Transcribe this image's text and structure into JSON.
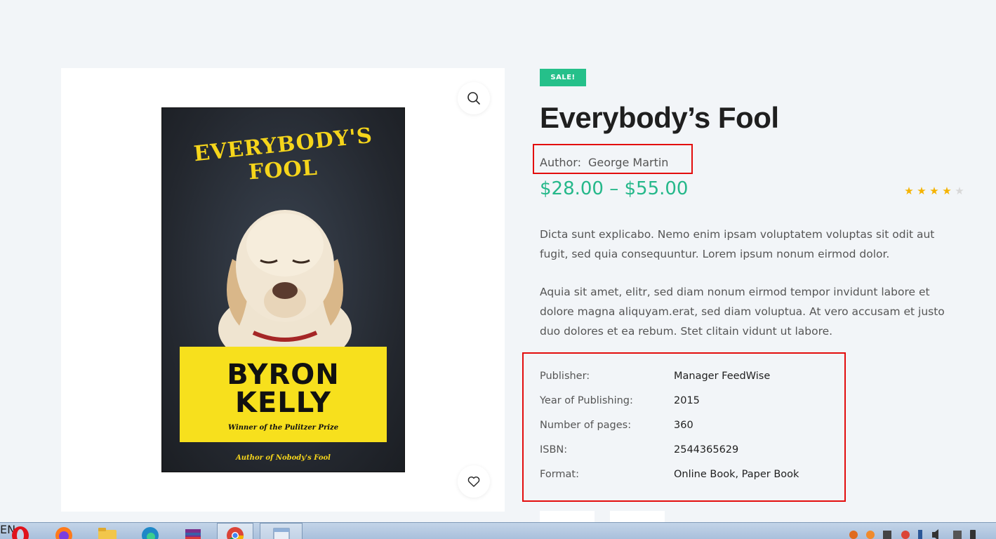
{
  "product": {
    "badge": "SALE!",
    "title": "Everybody’s Fool",
    "author_label": "Author:",
    "author_name": "George Martin",
    "price": "$28.00 – $55.00",
    "rating": 4,
    "rating_max": 5,
    "description": [
      "Dicta sunt explicabo. Nemo enim ipsam voluptatem voluptas sit odit aut fugit, sed quia consequuntur. Lorem ipsum nonum eirmod dolor.",
      "Aquia sit amet, elitr, sed diam nonum eirmod tempor invidunt labore et dolore magna aliquyam.erat, sed diam voluptua. At vero accusam et justo duo dolores et ea rebum. Stet clitain vidunt ut labore."
    ]
  },
  "cover": {
    "title_line1": "EVERYBODY'S",
    "title_line2": "FOOL",
    "author_line1": "BYRON",
    "author_line2": "KELLY",
    "tagline": "Winner of the Pulitzer Prize",
    "footer": "Author of Nobody's Fool"
  },
  "meta": [
    {
      "key": "Publisher:",
      "value": "Manager FeedWise"
    },
    {
      "key": "Year of Publishing:",
      "value": "2015"
    },
    {
      "key": "Number of pages:",
      "value": "360"
    },
    {
      "key": "ISBN:",
      "value": "2544365629"
    },
    {
      "key": "Format:",
      "value": "Online Book, Paper Book"
    }
  ],
  "icons": {
    "zoom": "magnifier-icon",
    "wishlist": "heart-icon",
    "star": "star-icon"
  },
  "colors": {
    "accent": "#25c08a",
    "price": "#25b88a",
    "star_filled": "#f5b301",
    "star_empty": "#d8d8d8",
    "highlight": "#e30d0d"
  },
  "taskbar": {
    "lang": "EN",
    "apps": [
      "opera-icon",
      "firefox-icon",
      "file-explorer-icon",
      "edge-icon",
      "winrar-icon",
      "chrome-icon",
      "app-window-icon"
    ]
  }
}
